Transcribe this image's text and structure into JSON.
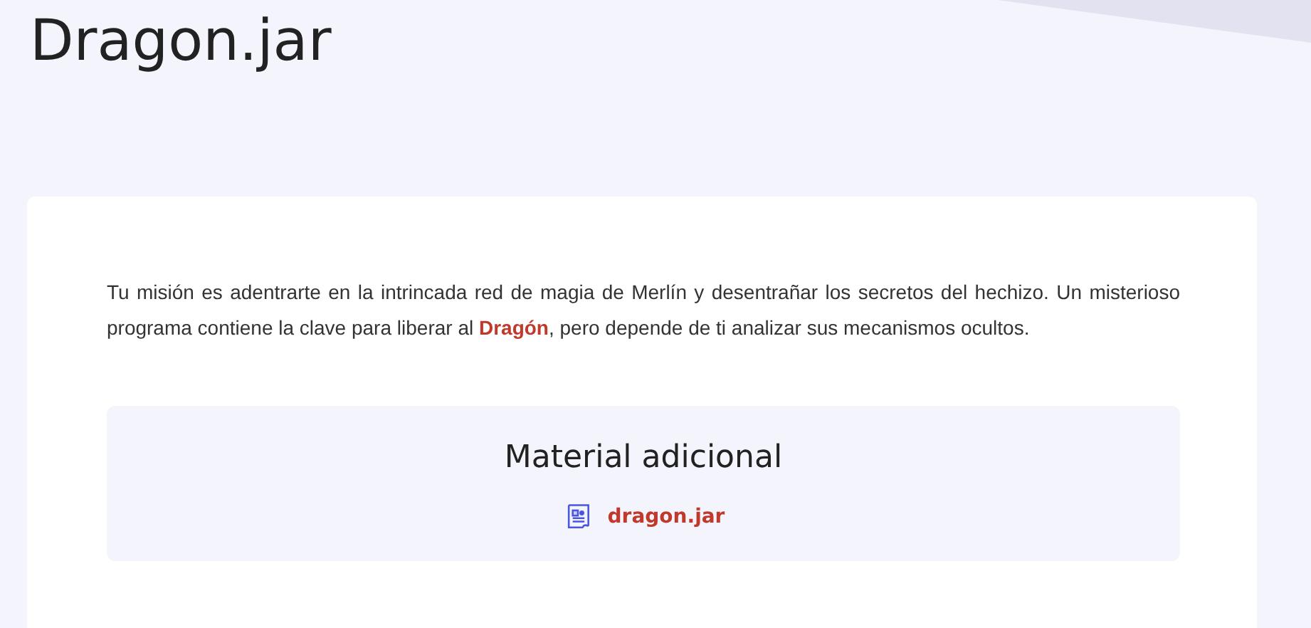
{
  "page": {
    "title": "Dragon.jar"
  },
  "card": {
    "description": "Tu misión es adentrarte en la intrincada red de magia de Merlín y desentrañar los secretos del hechizo. Un misterioso programa contiene la clave para liberar al **Dragón**, pero depende de ti analizar sus mecanismos ocultos.",
    "attachments": {
      "title": "Material adicional",
      "files": [
        {
          "name": "dragon.jar"
        }
      ]
    }
  }
}
